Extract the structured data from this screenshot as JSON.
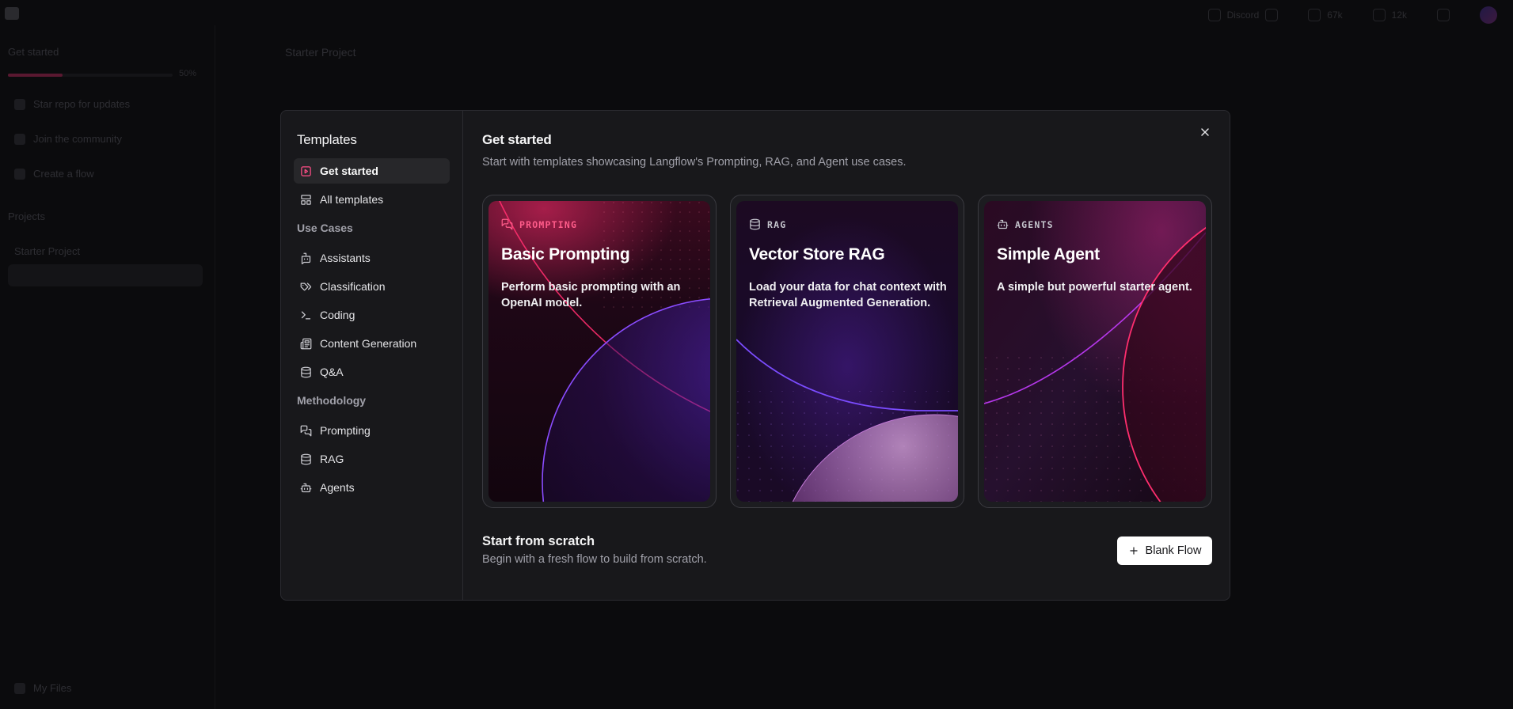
{
  "background": {
    "sidebar": {
      "get_started": "Get started",
      "progress_pct": "50%",
      "progress_fraction": 0.33,
      "star_repo": "Star repo for updates",
      "join_community": "Join the community",
      "create_flow": "Create a flow",
      "projects": "Projects",
      "starter_project": "Starter Project",
      "my_files": "My Files"
    },
    "header": {
      "breadcrumb": "Starter Project",
      "discord_label": "Discord",
      "github_stars": "67k",
      "discord_members": "12k"
    }
  },
  "modal": {
    "nav": {
      "title": "Templates",
      "items_top": [
        {
          "label": "Get started",
          "icon": "play-square-icon",
          "active": true
        },
        {
          "label": "All templates",
          "icon": "layout-grid-icon",
          "active": false
        }
      ],
      "use_cases_heading": "Use Cases",
      "use_cases": [
        {
          "label": "Assistants",
          "icon": "bot-message-icon"
        },
        {
          "label": "Classification",
          "icon": "tags-icon"
        },
        {
          "label": "Coding",
          "icon": "terminal-icon"
        },
        {
          "label": "Content Generation",
          "icon": "newspaper-icon"
        },
        {
          "label": "Q&A",
          "icon": "database-icon"
        }
      ],
      "methodology_heading": "Methodology",
      "methodology": [
        {
          "label": "Prompting",
          "icon": "messages-icon"
        },
        {
          "label": "RAG",
          "icon": "database-icon"
        },
        {
          "label": "Agents",
          "icon": "bot-icon"
        }
      ]
    },
    "main": {
      "title": "Get started",
      "subtitle": "Start with templates showcasing Langflow's Prompting, RAG, and Agent use cases.",
      "cards": [
        {
          "tag": "PROMPTING",
          "title": "Basic Prompting",
          "description": "Perform basic prompting with an OpenAI model.",
          "icon": "messages-icon",
          "tag_color": "#ff5c8a"
        },
        {
          "tag": "RAG",
          "title": "Vector Store RAG",
          "description": "Load your data for chat context with Retrieval Augmented Generation.",
          "icon": "database-icon",
          "tag_color": "#c4c4cc"
        },
        {
          "tag": "AGENTS",
          "title": "Simple Agent",
          "description": "A simple but powerful starter agent.",
          "icon": "bot-icon",
          "tag_color": "#c4c4cc"
        }
      ],
      "scratch": {
        "title": "Start from scratch",
        "subtitle": "Begin with a fresh flow to build from scratch.",
        "button_label": "Blank Flow"
      }
    }
  },
  "colors": {
    "accent_pink": "#ff2e6e",
    "accent_purple": "#7b3cff",
    "modal_bg": "#18181b"
  }
}
